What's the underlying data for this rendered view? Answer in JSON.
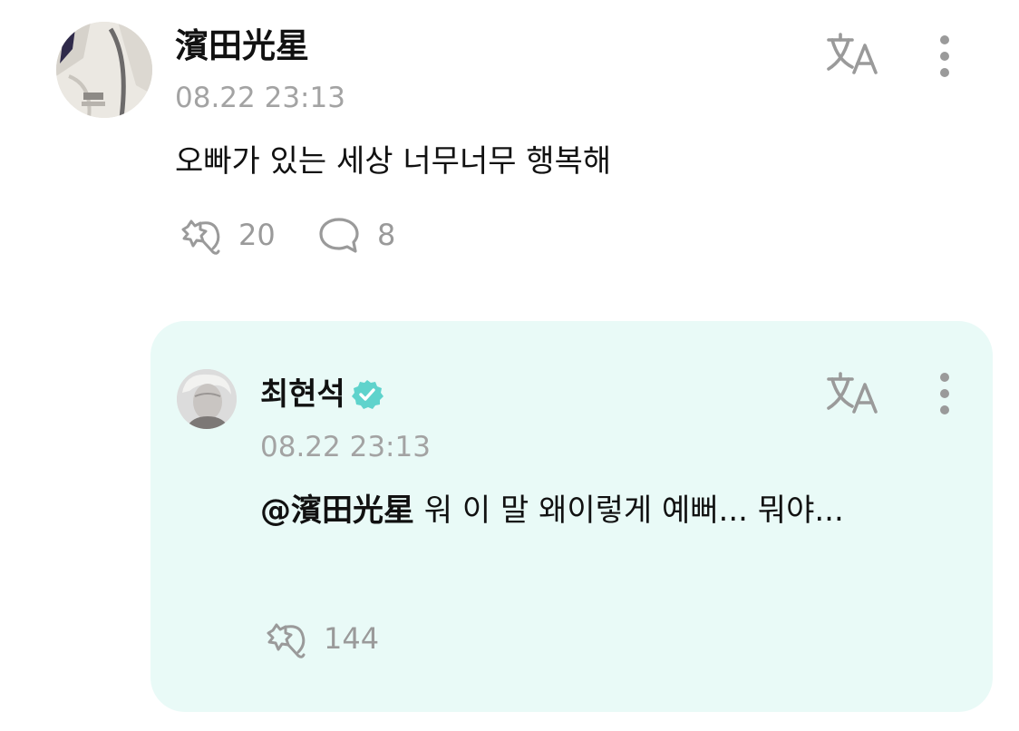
{
  "comment": {
    "author": "濱田光星",
    "timestamp": "08.22 23:13",
    "text": "오빠가 있는 세상 너무너무 행복해",
    "like_count": "20",
    "reply_count": "8"
  },
  "reply": {
    "author": "최현석",
    "verified": true,
    "timestamp": "08.22 23:13",
    "mention": "@濱田光星",
    "text": " 워 이 말 왜이렇게 예뻐... 뭐야...",
    "like_count": "144"
  },
  "colors": {
    "reply_background": "#e9faf7",
    "verified_badge": "#5fd3cc",
    "muted_text": "#a3a3a3"
  },
  "icons": {
    "translate": "translate-icon",
    "more": "more-vertical-icon",
    "like": "cheer-hand-icon",
    "reply": "speech-bubble-icon",
    "verified": "verified-badge-icon"
  }
}
